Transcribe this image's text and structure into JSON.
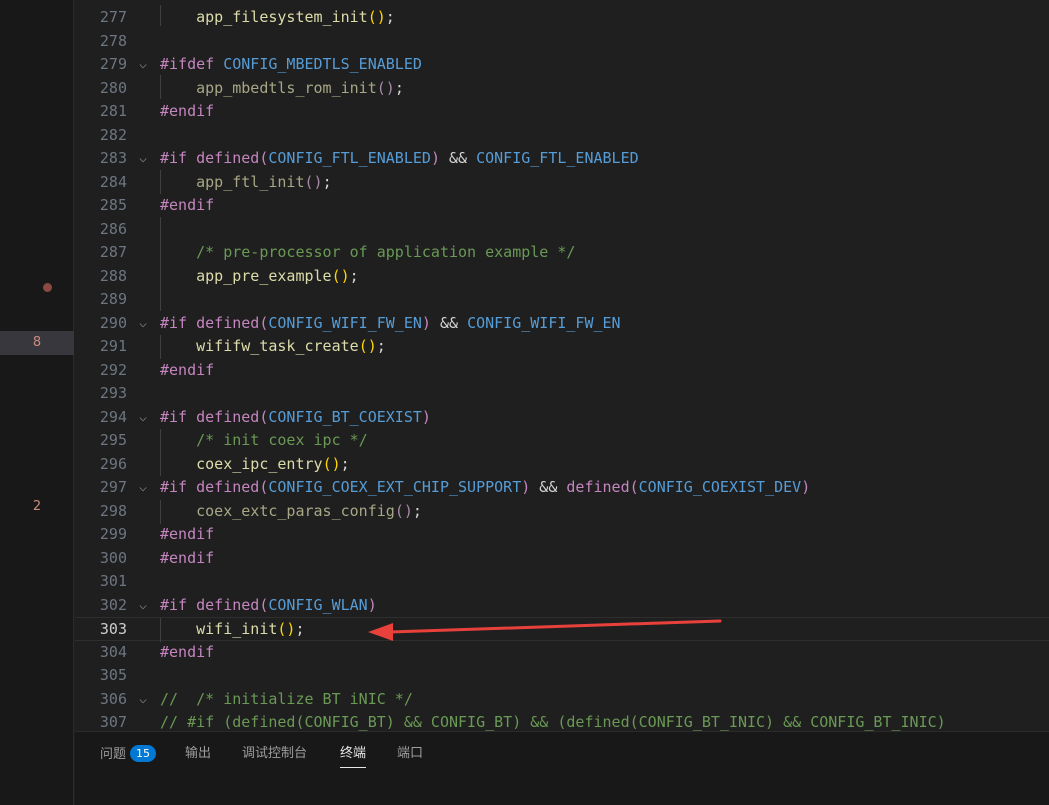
{
  "activity_bar": {
    "badges": [
      {
        "text": "8"
      },
      {
        "text": "2"
      }
    ]
  },
  "editor": {
    "current_line": "303",
    "lines": [
      {
        "num": "277",
        "fold": false,
        "tokens": [
          {
            "t": "    "
          },
          {
            "t": "app_filesystem_init",
            "c": "fn"
          },
          {
            "t": "()",
            "c": "paren"
          },
          {
            "t": ";"
          }
        ]
      },
      {
        "num": "278",
        "fold": false,
        "tokens": []
      },
      {
        "num": "279",
        "fold": true,
        "tokens": [
          {
            "t": "#ifdef",
            "c": "macro"
          },
          {
            "t": " "
          },
          {
            "t": "CONFIG_MBEDTLS_ENABLED",
            "c": "def"
          }
        ]
      },
      {
        "num": "280",
        "fold": false,
        "tokens": [
          {
            "t": "    "
          },
          {
            "t": "app_mbedtls_rom_init",
            "c": "fn-dim"
          },
          {
            "t": "()",
            "c": "paren-dim"
          },
          {
            "t": ";"
          }
        ]
      },
      {
        "num": "281",
        "fold": false,
        "tokens": [
          {
            "t": "#endif",
            "c": "macro"
          }
        ]
      },
      {
        "num": "282",
        "fold": false,
        "tokens": []
      },
      {
        "num": "283",
        "fold": true,
        "tokens": [
          {
            "t": "#if",
            "c": "macro"
          },
          {
            "t": " "
          },
          {
            "t": "defined",
            "c": "macro"
          },
          {
            "t": "(",
            "c": "macro"
          },
          {
            "t": "CONFIG_FTL_ENABLED",
            "c": "def"
          },
          {
            "t": ")",
            "c": "macro"
          },
          {
            "t": " && "
          },
          {
            "t": "CONFIG_FTL_ENABLED",
            "c": "def"
          }
        ]
      },
      {
        "num": "284",
        "fold": false,
        "tokens": [
          {
            "t": "    "
          },
          {
            "t": "app_ftl_init",
            "c": "fn-dim"
          },
          {
            "t": "()",
            "c": "paren-dim"
          },
          {
            "t": ";"
          }
        ]
      },
      {
        "num": "285",
        "fold": false,
        "tokens": [
          {
            "t": "#endif",
            "c": "macro"
          }
        ]
      },
      {
        "num": "286",
        "fold": false,
        "tokens": []
      },
      {
        "num": "287",
        "fold": false,
        "tokens": [
          {
            "t": "    "
          },
          {
            "t": "/* pre-processor of application example */",
            "c": "comment"
          }
        ]
      },
      {
        "num": "288",
        "fold": false,
        "tokens": [
          {
            "t": "    "
          },
          {
            "t": "app_pre_example",
            "c": "fn"
          },
          {
            "t": "()",
            "c": "paren"
          },
          {
            "t": ";"
          }
        ]
      },
      {
        "num": "289",
        "fold": false,
        "tokens": []
      },
      {
        "num": "290",
        "fold": true,
        "tokens": [
          {
            "t": "#if",
            "c": "macro"
          },
          {
            "t": " "
          },
          {
            "t": "defined",
            "c": "macro"
          },
          {
            "t": "(",
            "c": "macro"
          },
          {
            "t": "CONFIG_WIFI_FW_EN",
            "c": "def"
          },
          {
            "t": ")",
            "c": "macro"
          },
          {
            "t": " && "
          },
          {
            "t": "CONFIG_WIFI_FW_EN",
            "c": "def"
          }
        ]
      },
      {
        "num": "291",
        "fold": false,
        "tokens": [
          {
            "t": "    "
          },
          {
            "t": "wififw_task_create",
            "c": "fn"
          },
          {
            "t": "()",
            "c": "paren"
          },
          {
            "t": ";"
          }
        ]
      },
      {
        "num": "292",
        "fold": false,
        "tokens": [
          {
            "t": "#endif",
            "c": "macro"
          }
        ]
      },
      {
        "num": "293",
        "fold": false,
        "tokens": []
      },
      {
        "num": "294",
        "fold": true,
        "tokens": [
          {
            "t": "#if",
            "c": "macro"
          },
          {
            "t": " "
          },
          {
            "t": "defined",
            "c": "macro"
          },
          {
            "t": "(",
            "c": "macro"
          },
          {
            "t": "CONFIG_BT_COEXIST",
            "c": "def"
          },
          {
            "t": ")",
            "c": "macro"
          }
        ]
      },
      {
        "num": "295",
        "fold": false,
        "tokens": [
          {
            "t": "    "
          },
          {
            "t": "/* init coex ipc */",
            "c": "comment"
          }
        ]
      },
      {
        "num": "296",
        "fold": false,
        "tokens": [
          {
            "t": "    "
          },
          {
            "t": "coex_ipc_entry",
            "c": "fn"
          },
          {
            "t": "()",
            "c": "paren"
          },
          {
            "t": ";"
          }
        ]
      },
      {
        "num": "297",
        "fold": true,
        "tokens": [
          {
            "t": "#if",
            "c": "macro"
          },
          {
            "t": " "
          },
          {
            "t": "defined",
            "c": "macro"
          },
          {
            "t": "(",
            "c": "macro"
          },
          {
            "t": "CONFIG_COEX_EXT_CHIP_SUPPORT",
            "c": "def"
          },
          {
            "t": ")",
            "c": "macro"
          },
          {
            "t": " && "
          },
          {
            "t": "defined",
            "c": "macro"
          },
          {
            "t": "(",
            "c": "macro"
          },
          {
            "t": "CONFIG_COEXIST_DEV",
            "c": "def"
          },
          {
            "t": ")",
            "c": "macro"
          }
        ]
      },
      {
        "num": "298",
        "fold": false,
        "tokens": [
          {
            "t": "    "
          },
          {
            "t": "coex_extc_paras_config",
            "c": "fn-dim"
          },
          {
            "t": "()",
            "c": "paren-dim"
          },
          {
            "t": ";"
          }
        ]
      },
      {
        "num": "299",
        "fold": false,
        "tokens": [
          {
            "t": "#endif",
            "c": "macro"
          }
        ]
      },
      {
        "num": "300",
        "fold": false,
        "tokens": [
          {
            "t": "#endif",
            "c": "macro"
          }
        ]
      },
      {
        "num": "301",
        "fold": false,
        "tokens": []
      },
      {
        "num": "302",
        "fold": true,
        "tokens": [
          {
            "t": "#if",
            "c": "macro"
          },
          {
            "t": " "
          },
          {
            "t": "defined",
            "c": "macro"
          },
          {
            "t": "(",
            "c": "macro"
          },
          {
            "t": "CONFIG_WLAN",
            "c": "def"
          },
          {
            "t": ")",
            "c": "macro"
          }
        ]
      },
      {
        "num": "303",
        "fold": false,
        "tokens": [
          {
            "t": "    "
          },
          {
            "t": "wifi_init",
            "c": "fn"
          },
          {
            "t": "()",
            "c": "paren"
          },
          {
            "t": ";"
          }
        ]
      },
      {
        "num": "304",
        "fold": false,
        "tokens": [
          {
            "t": "#endif",
            "c": "macro"
          }
        ]
      },
      {
        "num": "305",
        "fold": false,
        "tokens": []
      },
      {
        "num": "306",
        "fold": true,
        "tokens": [
          {
            "t": "//  /* initialize BT iNIC */",
            "c": "comment"
          }
        ]
      },
      {
        "num": "307",
        "fold": false,
        "tokens": [
          {
            "t": "// #if (defined(CONFIG_BT) && CONFIG_BT) && (defined(CONFIG_BT_INIC) && CONFIG_BT_INIC)",
            "c": "comment"
          }
        ]
      }
    ]
  },
  "panel": {
    "tabs": [
      {
        "label": "问题",
        "badge": "15",
        "active": false
      },
      {
        "label": "输出",
        "active": false
      },
      {
        "label": "调试控制台",
        "active": false
      },
      {
        "label": "终端",
        "active": true
      },
      {
        "label": "端口",
        "active": false
      }
    ]
  },
  "colors": {
    "background": "#1f1f1f",
    "macro": "#c586c0",
    "define": "#569cd6",
    "function": "#dcdcaa",
    "comment": "#6a9955",
    "annotation_arrow": "#e8413b",
    "badge": "#0078d4"
  },
  "icons": {
    "fold": "chevron-down-icon",
    "breakpoint": "breakpoint-dot-icon",
    "annotation": "red-arrow"
  }
}
